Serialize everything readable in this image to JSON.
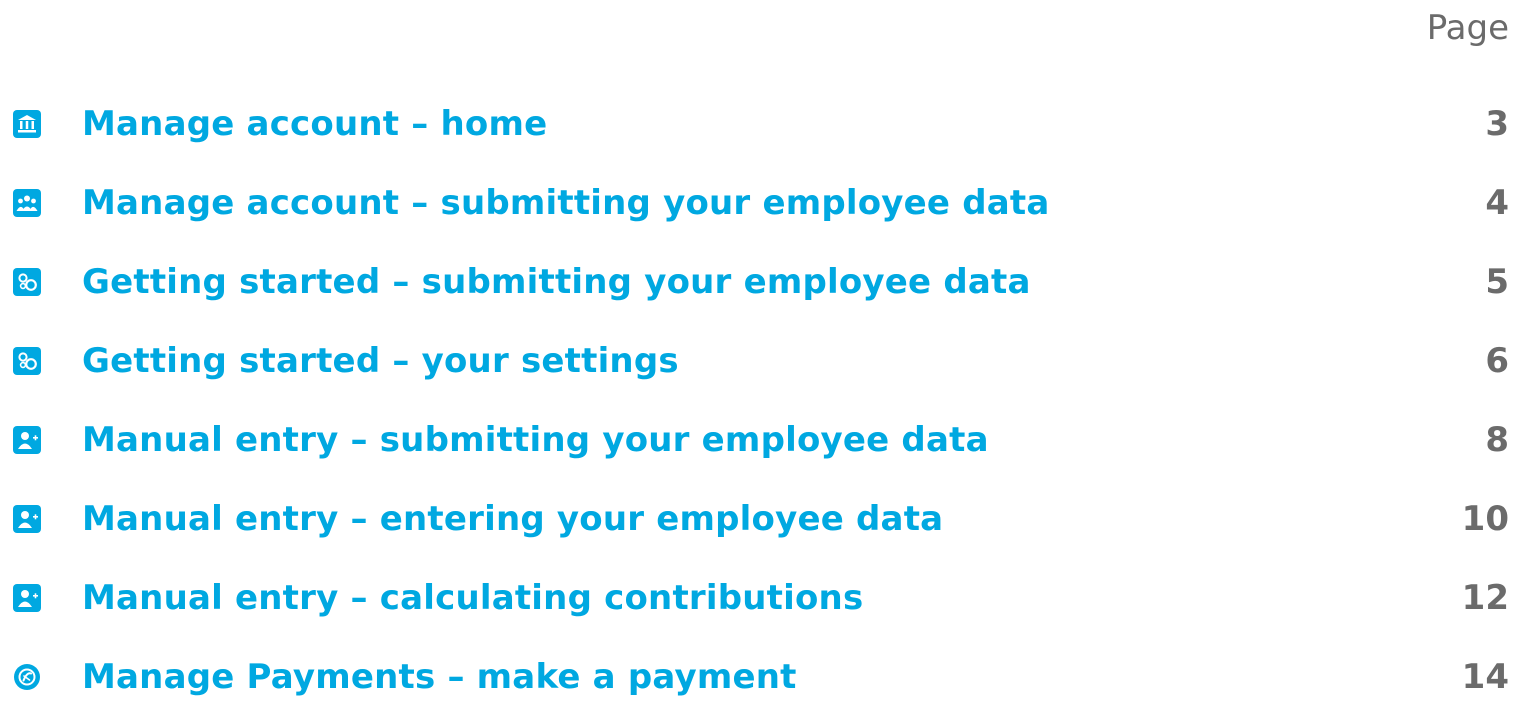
{
  "header": {
    "page_label": "Page"
  },
  "colors": {
    "accent": "#00a8e1",
    "page_number": "#6b6b6b"
  },
  "toc": [
    {
      "icon": "bank-icon",
      "title": "Manage account – home",
      "page": "3"
    },
    {
      "icon": "people-icon",
      "title": "Manage account – submitting your employee data",
      "page": "4"
    },
    {
      "icon": "gears-icon",
      "title": "Getting started – submitting your employee data",
      "page": "5"
    },
    {
      "icon": "gears-icon",
      "title": "Getting started – your settings",
      "page": "6"
    },
    {
      "icon": "add-user-icon",
      "title": "Manual entry – submitting your employee data",
      "page": "8"
    },
    {
      "icon": "add-user-icon",
      "title": "Manual entry – entering your employee data",
      "page": "10"
    },
    {
      "icon": "add-user-icon",
      "title": "Manual entry – calculating contributions",
      "page": "12"
    },
    {
      "icon": "payment-icon",
      "title": "Manage Payments – make a payment",
      "page": "14"
    }
  ]
}
